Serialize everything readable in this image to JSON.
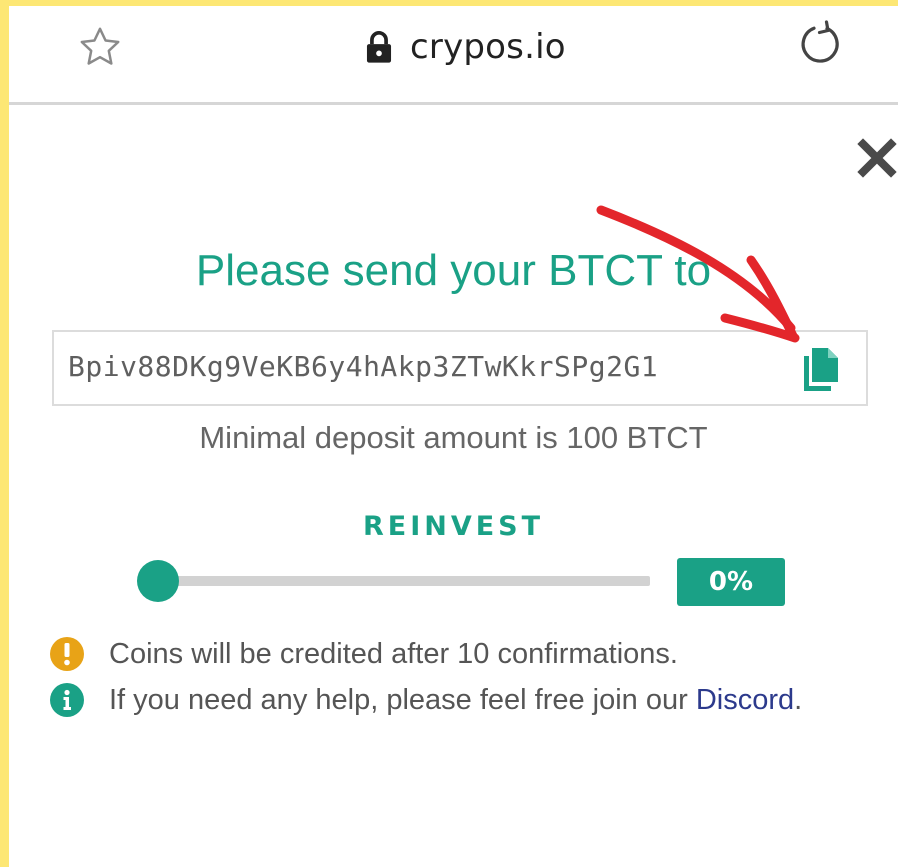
{
  "browser": {
    "url": "crypos.io",
    "icons": [
      "star-icon",
      "lock-icon",
      "reload-icon"
    ]
  },
  "modal": {
    "title": "Please send your BTCT to",
    "address": "Bpiv88DKg9VeKB6y4hAkp3ZTwKkrSPg2G1",
    "min_deposit": "Minimal deposit amount is 100 BTCT",
    "reinvest": {
      "label": "REINVEST",
      "value_percent": 0,
      "display": "0%"
    },
    "notes": {
      "confirmations": "Coins will be credited after 10 confirmations.",
      "help_prefix": "If you need any help, please feel free join our ",
      "help_link": "Discord",
      "help_suffix": "."
    }
  },
  "colors": {
    "accent": "#1aa186",
    "warning": "#e8a317",
    "link": "#2c3a8c",
    "annotation": "#e3262b",
    "page_border": "#fde774"
  }
}
